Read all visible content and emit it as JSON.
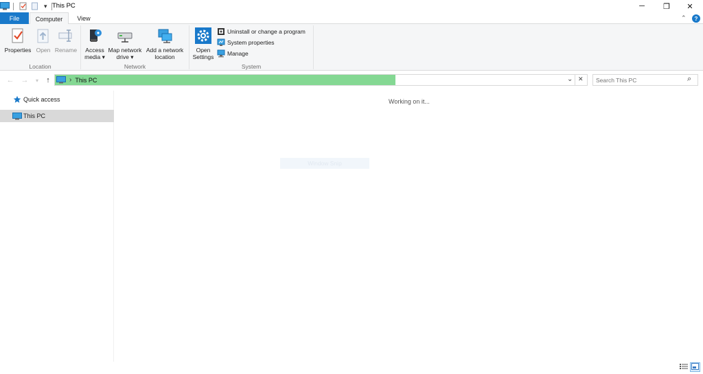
{
  "window": {
    "title": "This PC",
    "qat_dropdown_glyph": "▾",
    "minimize_glyph": "─",
    "restore_glyph": "❐",
    "close_glyph": "✕"
  },
  "ribbon_tabs": {
    "file": "File",
    "computer": "Computer",
    "view": "View",
    "collapse_glyph": "⌃",
    "help_glyph": "?"
  },
  "ribbon": {
    "location": {
      "label": "Location",
      "properties": "Properties",
      "open": "Open",
      "rename": "Rename"
    },
    "network": {
      "label": "Network",
      "access_media_line1": "Access",
      "access_media_line2": "media ▾",
      "map_drive_line1": "Map network",
      "map_drive_line2": "drive ▾",
      "add_location_line1": "Add a network",
      "add_location_line2": "location"
    },
    "system": {
      "label": "System",
      "open_settings_line1": "Open",
      "open_settings_line2": "Settings",
      "uninstall": "Uninstall or change a program",
      "system_properties": "System properties",
      "manage": "Manage"
    }
  },
  "address_bar": {
    "back_glyph": "←",
    "forward_glyph": "→",
    "recent_glyph": "▾",
    "up_glyph": "↑",
    "separator_glyph": "›",
    "path": "This PC",
    "dropdown_glyph": "⌄",
    "stop_glyph": "✕",
    "progress": 0.64
  },
  "search": {
    "placeholder": "Search This PC",
    "icon_glyph": "⌕"
  },
  "nav_pane": {
    "quick_access": "Quick access",
    "this_pc": "This PC",
    "selected": "This PC"
  },
  "content": {
    "status": "Working on it...",
    "overlay_text": "Window Snip"
  },
  "colors": {
    "accent": "#1979ca",
    "progress": "#84d893",
    "selection": "#d9d9d9",
    "ribbon_bg": "#f5f6f7"
  }
}
